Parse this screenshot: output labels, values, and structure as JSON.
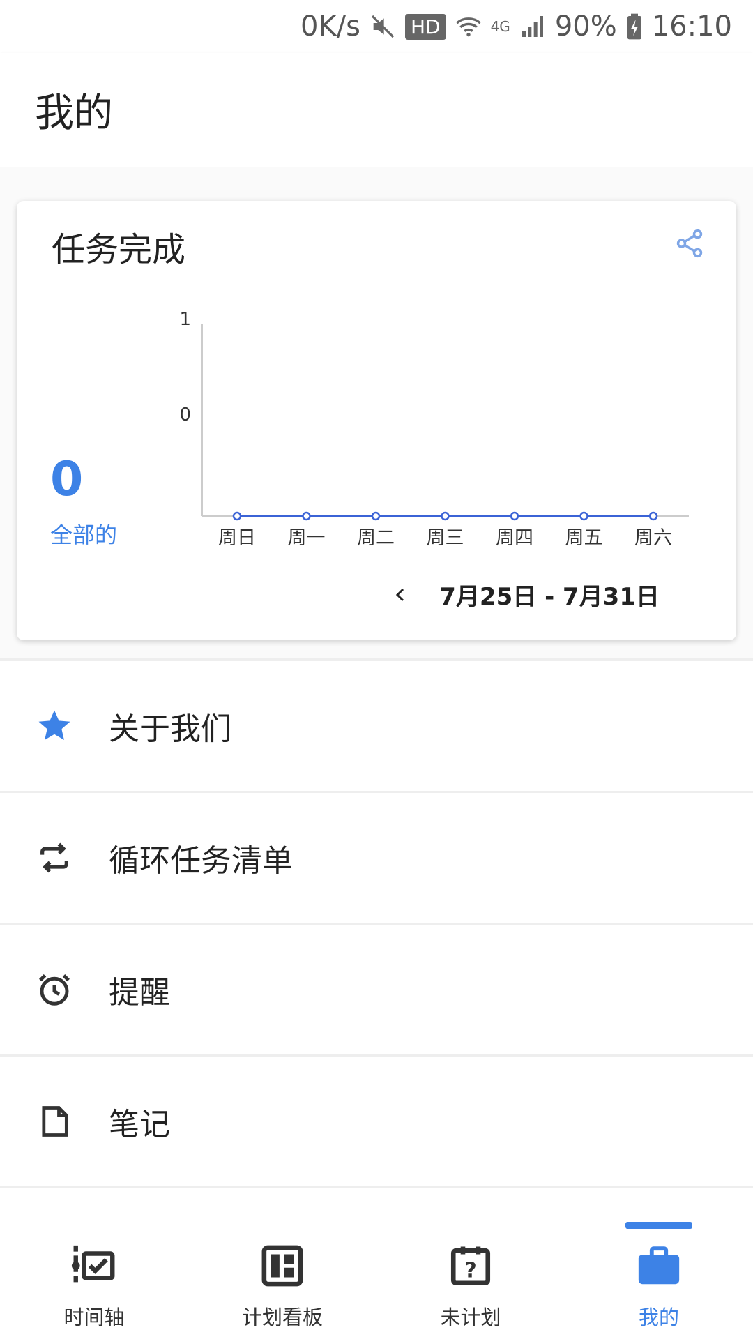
{
  "status_bar": {
    "speed": "0K/s",
    "hd": "HD",
    "network": "4G",
    "battery": "90%",
    "time": "16:10"
  },
  "header": {
    "title": "我的"
  },
  "stats_card": {
    "title": "任务完成",
    "total_value": "0",
    "total_label": "全部的",
    "date_range": "7月25日 - 7月31日"
  },
  "chart_data": {
    "type": "line",
    "categories": [
      "周日",
      "周一",
      "周二",
      "周三",
      "周四",
      "周五",
      "周六"
    ],
    "values": [
      0,
      0,
      0,
      0,
      0,
      0,
      0
    ],
    "y_ticks": [
      "1",
      "0"
    ],
    "color": "#3b63d6"
  },
  "menu": {
    "items": [
      {
        "label": "关于我们",
        "icon": "star-icon"
      },
      {
        "label": "循环任务清单",
        "icon": "repeat-icon"
      },
      {
        "label": "提醒",
        "icon": "alarm-icon"
      },
      {
        "label": "笔记",
        "icon": "note-icon"
      }
    ]
  },
  "bottom_nav": {
    "items": [
      {
        "label": "时间轴",
        "icon": "timeline-icon"
      },
      {
        "label": "计划看板",
        "icon": "board-icon"
      },
      {
        "label": "未计划",
        "icon": "unplanned-icon"
      },
      {
        "label": "我的",
        "icon": "briefcase-icon"
      }
    ],
    "active_index": 3
  },
  "colors": {
    "accent": "#3d82e6",
    "line": "#3b63d6"
  }
}
